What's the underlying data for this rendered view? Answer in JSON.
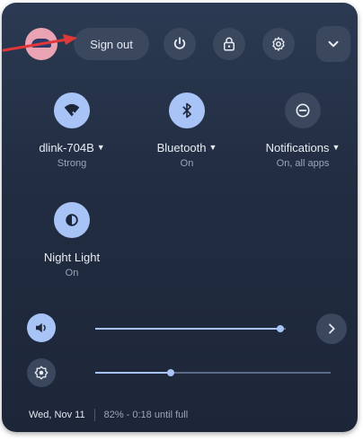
{
  "header": {
    "sign_out_label": "Sign out"
  },
  "tiles": [
    {
      "label": "dlink-704B",
      "sublabel": "Strong",
      "icon": "wifi-icon",
      "active": true
    },
    {
      "label": "Bluetooth",
      "sublabel": "On",
      "icon": "bluetooth-icon",
      "active": true
    },
    {
      "label": "Notifications",
      "sublabel": "On, all apps",
      "icon": "notifications-icon",
      "active": false
    },
    {
      "label": "Night Light",
      "sublabel": "On",
      "icon": "night-light-icon",
      "active": true
    }
  ],
  "volume": {
    "icon": "speaker-icon",
    "level": 0.97
  },
  "brightness": {
    "icon": "brightness-icon",
    "level": 0.32
  },
  "footer": {
    "date": "Wed, Nov 11",
    "battery": "82% - 0:18 until full"
  },
  "colors": {
    "accent": "#a8c4f7",
    "panel": "#222d42",
    "annotation_arrow": "#e0383a"
  }
}
